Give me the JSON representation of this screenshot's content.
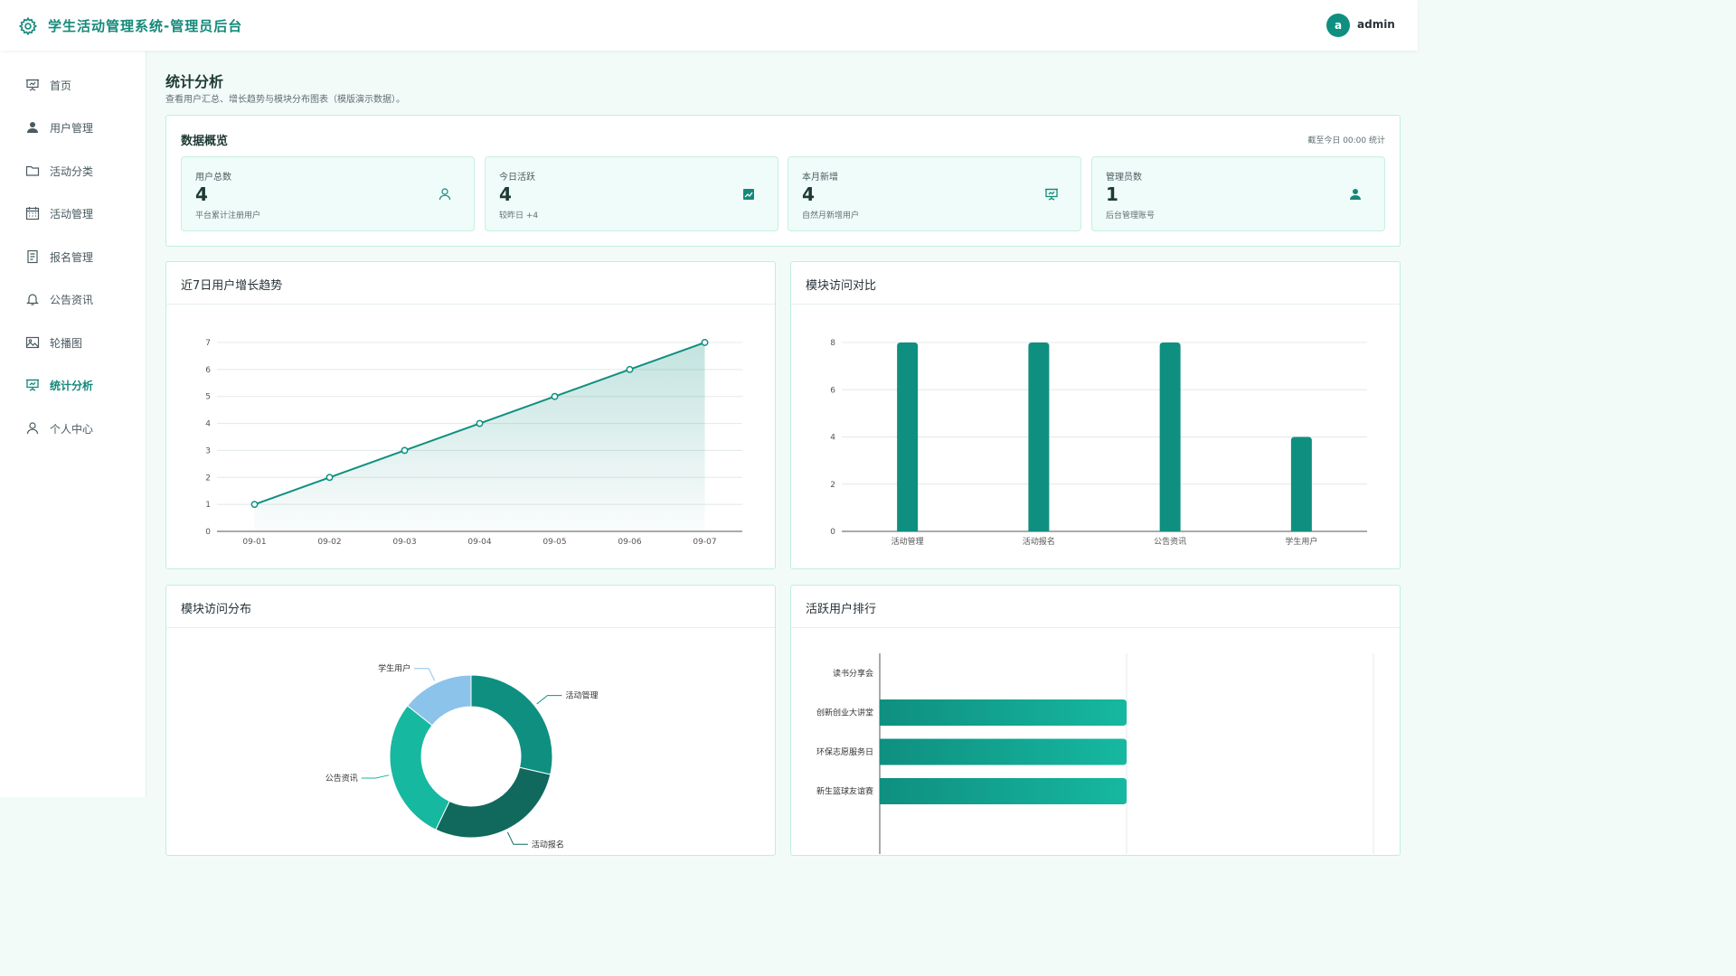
{
  "header": {
    "title": "学生活动管理系统-管理员后台",
    "avatar_letter": "a",
    "username": "admin"
  },
  "sidebar": {
    "items": [
      {
        "label": "首页",
        "icon": "presentation-icon",
        "active": false
      },
      {
        "label": "用户管理",
        "icon": "user-filled-icon",
        "active": false
      },
      {
        "label": "活动分类",
        "icon": "folder-icon",
        "active": false
      },
      {
        "label": "活动管理",
        "icon": "calendar-icon",
        "active": false
      },
      {
        "label": "报名管理",
        "icon": "document-icon",
        "active": false
      },
      {
        "label": "公告资讯",
        "icon": "bell-icon",
        "active": false
      },
      {
        "label": "轮播图",
        "icon": "picture-icon",
        "active": false
      },
      {
        "label": "统计分析",
        "icon": "presentation-icon",
        "active": true
      },
      {
        "label": "个人中心",
        "icon": "user-outline-icon",
        "active": false
      }
    ]
  },
  "page": {
    "title": "统计分析",
    "description": "查看用户汇总、增长趋势与模块分布图表（模版演示数据）。"
  },
  "overview": {
    "title": "数据概览",
    "note": "截至今日 00:00 统计",
    "stats": [
      {
        "label": "用户总数",
        "value": "4",
        "desc": "平台累计注册用户",
        "icon": "user-outline-icon"
      },
      {
        "label": "今日活跃",
        "value": "4",
        "desc": "较昨日 +4",
        "icon": "trend-chart-icon"
      },
      {
        "label": "本月新增",
        "value": "4",
        "desc": "自然月新增用户",
        "icon": "presentation-icon"
      },
      {
        "label": "管理员数",
        "value": "1",
        "desc": "后台管理账号",
        "icon": "user-filled-icon"
      }
    ]
  },
  "colors": {
    "accent": "#0f8f80",
    "accent_light": "#16b8a0",
    "light_blue": "#8bc3ea",
    "dark_teal": "#10695c"
  },
  "chart_data": [
    {
      "type": "area",
      "title": "近7日用户增长趋势",
      "categories": [
        "09-01",
        "09-02",
        "09-03",
        "09-04",
        "09-05",
        "09-06",
        "09-07"
      ],
      "values": [
        1,
        2,
        3,
        4,
        5,
        6,
        7
      ],
      "ylim": [
        0,
        7
      ],
      "yticks": [
        0,
        1,
        2,
        3,
        4,
        5,
        6,
        7
      ],
      "grid": true
    },
    {
      "type": "bar",
      "title": "模块访问对比",
      "categories": [
        "活动管理",
        "活动报名",
        "公告资讯",
        "学生用户"
      ],
      "values": [
        8,
        8,
        8,
        4
      ],
      "ylim": [
        0,
        8
      ],
      "yticks": [
        0,
        2,
        4,
        6,
        8
      ],
      "grid": true
    },
    {
      "type": "pie",
      "title": "模块访问分布",
      "labels": [
        "活动管理",
        "活动报名",
        "公告资讯",
        "学生用户"
      ],
      "values": [
        8,
        8,
        8,
        4
      ],
      "donut": true
    },
    {
      "type": "bar",
      "orientation": "horizontal",
      "title": "活跃用户排行",
      "categories": [
        "读书分享会",
        "创新创业大讲堂",
        "环保志愿服务日",
        "新生篮球友谊赛"
      ],
      "values": [
        0,
        1,
        1,
        1
      ],
      "xlim": [
        0,
        2
      ]
    }
  ]
}
